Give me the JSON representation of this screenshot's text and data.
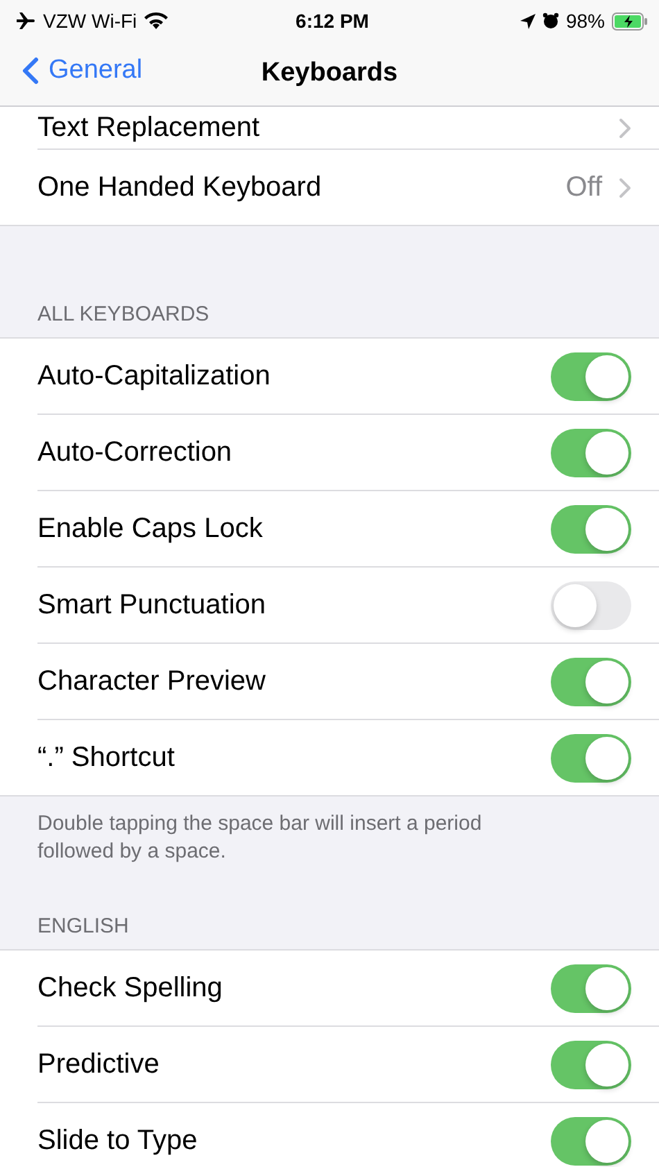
{
  "status_bar": {
    "carrier": "VZW Wi-Fi",
    "time": "6:12 PM",
    "battery": "98%"
  },
  "nav": {
    "back": "General",
    "title": "Keyboards"
  },
  "sections": [
    {
      "rows": [
        {
          "kind": "link",
          "label": "Text Replacement"
        },
        {
          "kind": "link",
          "label": "One Handed Keyboard",
          "value": "Off"
        }
      ]
    },
    {
      "header": "ALL KEYBOARDS",
      "rows": [
        {
          "kind": "toggle",
          "label": "Auto-Capitalization",
          "on": true
        },
        {
          "kind": "toggle",
          "label": "Auto-Correction",
          "on": true
        },
        {
          "kind": "toggle",
          "label": "Enable Caps Lock",
          "on": true
        },
        {
          "kind": "toggle",
          "label": "Smart Punctuation",
          "on": false
        },
        {
          "kind": "toggle",
          "label": "Character Preview",
          "on": true
        },
        {
          "kind": "toggle",
          "label": "“.” Shortcut",
          "on": true
        }
      ],
      "footer": "Double tapping the space bar will insert a period followed by a space."
    },
    {
      "header": "ENGLISH",
      "rows": [
        {
          "kind": "toggle",
          "label": "Check Spelling",
          "on": true
        },
        {
          "kind": "toggle",
          "label": "Predictive",
          "on": true
        },
        {
          "kind": "toggle",
          "label": "Slide to Type",
          "on": true
        }
      ]
    }
  ]
}
